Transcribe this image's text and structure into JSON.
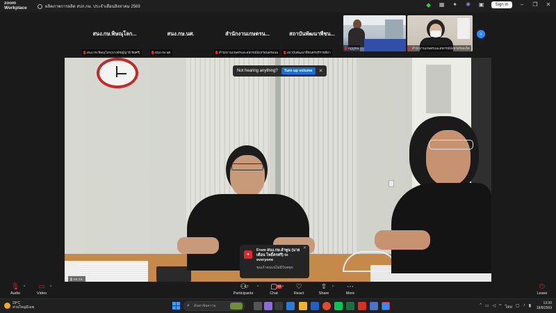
{
  "window": {
    "app_name_top": "zoom",
    "app_name_bottom": "Workplace",
    "meeting_title": "ผลิตภาพการผลิต สปก.กษ. ประจำเดือนสิงหาคม 2569",
    "sign_in_label": "Sign in"
  },
  "participants_strip": [
    {
      "name": "สนง.กษ.พิษณุโลก...",
      "label": "สนง.กษ.พิษณุโลก(นางพัชญ์ญานี ชัยศรี)"
    },
    {
      "name": "สนง.กษ.นศ.",
      "label": "สนง.กษ.นศ."
    },
    {
      "name": "สำนักงานเกษตรน...",
      "label": "สำนักงานเกษตรและสหกรณ์จังหวัดนครพนม"
    },
    {
      "name": "สถาบันพัฒนาพืชน...",
      "label": "สถาบันพัฒนาพืชนครบุรีราชสีมา"
    },
    {
      "name": "",
      "label": "กฎบูรณ"
    },
    {
      "name": "",
      "label": "สำนักงานเกษตรและสหกรณ์จังหวัดร้อยเอ็ด"
    }
  ],
  "toast": {
    "text": "Not hearing anything?",
    "button": "Turn up volume"
  },
  "chat_notification": {
    "from": "From สนง.กษ.ลำพูน (นายเดือน โพธิ์ครศรี) to everyone",
    "message": "ขุนเก้าคนแน่ไม่มีวันหยุด"
  },
  "main_video_label": "ผอ.กษ.",
  "toolbar": {
    "audio": "Audio",
    "video": "Video",
    "participants": "Participants",
    "participants_count": "67",
    "chat": "Chat",
    "chat_badge": "14",
    "react": "React",
    "share": "Share",
    "more": "More",
    "leave": "Leave"
  },
  "taskbar": {
    "temperature": "29°C",
    "weather": "ส่วนใหญ่มีเมฆ",
    "search_placeholder": "ค้นหาข้อความ",
    "language": "ไทย",
    "time": "13:30",
    "date": "18/8/2569"
  }
}
